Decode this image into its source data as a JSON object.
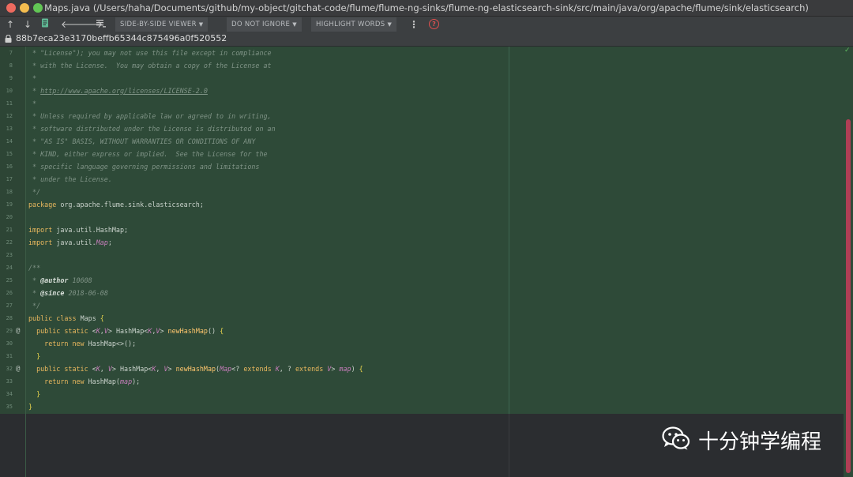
{
  "window": {
    "title": "Maps.java (/Users/haha/Documents/github/my-object/gitchat-code/flume/flume-ng-sinks/flume-ng-elasticsearch-sink/src/main/java/org/apache/flume/sink/elasticsearch)"
  },
  "toolbar": {
    "icons": [
      "arrow-up-icon",
      "arrow-down-icon",
      "edit-source-icon",
      "arrow-left-icon",
      "arrow-right-icon",
      "list-icon",
      "more-icon",
      "help-icon"
    ],
    "viewer_label": "SIDE-BY-SIDE VIEWER",
    "ignore_label": "DO NOT IGNORE",
    "highlight_label": "HIGHLIGHT WORDS",
    "more_symbol": "⋮",
    "help_symbol": "?"
  },
  "revision": {
    "hash": "88b7eca23e3170beffb65344c875496a0f520552"
  },
  "editor": {
    "lines": [
      {
        "n": "7",
        "mark": "",
        "tokens": [
          {
            "c": "cm",
            "t": " * \"License\"); you may not use this file except in compliance"
          }
        ]
      },
      {
        "n": "8",
        "mark": "",
        "tokens": [
          {
            "c": "cm",
            "t": " * with the License.  You may obtain a copy of the License at"
          }
        ]
      },
      {
        "n": "9",
        "mark": "",
        "tokens": [
          {
            "c": "cm",
            "t": " *"
          }
        ]
      },
      {
        "n": "10",
        "mark": "",
        "tokens": [
          {
            "c": "cm",
            "t": " * "
          },
          {
            "c": "cm-link",
            "t": "http://www.apache.org/licenses/LICENSE-2.0"
          }
        ]
      },
      {
        "n": "11",
        "mark": "",
        "tokens": [
          {
            "c": "cm",
            "t": " *"
          }
        ]
      },
      {
        "n": "12",
        "mark": "",
        "tokens": [
          {
            "c": "cm",
            "t": " * Unless required by applicable law or agreed to in writing,"
          }
        ]
      },
      {
        "n": "13",
        "mark": "",
        "tokens": [
          {
            "c": "cm",
            "t": " * software distributed under the License is distributed on an"
          }
        ]
      },
      {
        "n": "14",
        "mark": "",
        "tokens": [
          {
            "c": "cm",
            "t": " * \"AS IS\" BASIS, WITHOUT WARRANTIES OR CONDITIONS OF ANY"
          }
        ]
      },
      {
        "n": "15",
        "mark": "",
        "tokens": [
          {
            "c": "cm",
            "t": " * KIND, either express or implied.  See the License for the"
          }
        ]
      },
      {
        "n": "16",
        "mark": "",
        "tokens": [
          {
            "c": "cm",
            "t": " * specific language governing permissions and limitations"
          }
        ]
      },
      {
        "n": "17",
        "mark": "",
        "tokens": [
          {
            "c": "cm",
            "t": " * under the License."
          }
        ]
      },
      {
        "n": "18",
        "mark": "",
        "tokens": [
          {
            "c": "cm",
            "t": " */"
          }
        ]
      },
      {
        "n": "19",
        "mark": "",
        "tokens": [
          {
            "c": "kw",
            "t": "package "
          },
          {
            "c": "pkg",
            "t": "org.apache.flume.sink.elasticsearch;"
          }
        ]
      },
      {
        "n": "20",
        "mark": "",
        "tokens": []
      },
      {
        "n": "21",
        "mark": "",
        "tokens": [
          {
            "c": "kw",
            "t": "import "
          },
          {
            "c": "pkg",
            "t": "java.util.HashMap;"
          }
        ]
      },
      {
        "n": "22",
        "mark": "",
        "tokens": [
          {
            "c": "kw",
            "t": "import "
          },
          {
            "c": "pkg",
            "t": "java.util."
          },
          {
            "c": "typ",
            "t": "Map"
          },
          {
            "c": "pkg",
            "t": ";"
          }
        ]
      },
      {
        "n": "23",
        "mark": "",
        "tokens": []
      },
      {
        "n": "24",
        "mark": "",
        "tokens": [
          {
            "c": "cm",
            "t": "/**"
          }
        ]
      },
      {
        "n": "25",
        "mark": "",
        "tokens": [
          {
            "c": "cm",
            "t": " * "
          },
          {
            "c": "tag",
            "t": "@author"
          },
          {
            "c": "cm",
            "t": " 10608"
          }
        ]
      },
      {
        "n": "26",
        "mark": "",
        "tokens": [
          {
            "c": "cm",
            "t": " * "
          },
          {
            "c": "tag",
            "t": "@since"
          },
          {
            "c": "cm",
            "t": " 2018-06-08"
          }
        ]
      },
      {
        "n": "27",
        "mark": "",
        "tokens": [
          {
            "c": "cm",
            "t": " */"
          }
        ]
      },
      {
        "n": "28",
        "mark": "",
        "tokens": [
          {
            "c": "kw",
            "t": "public class "
          },
          {
            "c": "cls",
            "t": "Maps "
          },
          {
            "c": "brace",
            "t": "{"
          }
        ]
      },
      {
        "n": "29",
        "mark": "@",
        "tokens": [
          {
            "c": "plain",
            "t": "  "
          },
          {
            "c": "kw",
            "t": "public static "
          },
          {
            "c": "plain",
            "t": "<"
          },
          {
            "c": "typ",
            "t": "K"
          },
          {
            "c": "plain",
            "t": ","
          },
          {
            "c": "typ",
            "t": "V"
          },
          {
            "c": "plain",
            "t": "> HashMap<"
          },
          {
            "c": "typ",
            "t": "K"
          },
          {
            "c": "plain",
            "t": ","
          },
          {
            "c": "typ",
            "t": "V"
          },
          {
            "c": "plain",
            "t": "> "
          },
          {
            "c": "fn",
            "t": "newHashMap"
          },
          {
            "c": "plain",
            "t": "() "
          },
          {
            "c": "brace",
            "t": "{"
          }
        ]
      },
      {
        "n": "30",
        "mark": "",
        "tokens": [
          {
            "c": "plain",
            "t": "    "
          },
          {
            "c": "kw",
            "t": "return new "
          },
          {
            "c": "plain",
            "t": "HashMap<>();"
          }
        ]
      },
      {
        "n": "31",
        "mark": "",
        "tokens": [
          {
            "c": "plain",
            "t": "  "
          },
          {
            "c": "brace",
            "t": "}"
          }
        ]
      },
      {
        "n": "32",
        "mark": "@",
        "tokens": [
          {
            "c": "plain",
            "t": "  "
          },
          {
            "c": "kw",
            "t": "public static "
          },
          {
            "c": "plain",
            "t": "<"
          },
          {
            "c": "typ",
            "t": "K"
          },
          {
            "c": "plain",
            "t": ", "
          },
          {
            "c": "typ",
            "t": "V"
          },
          {
            "c": "plain",
            "t": "> HashMap<"
          },
          {
            "c": "typ",
            "t": "K"
          },
          {
            "c": "plain",
            "t": ", "
          },
          {
            "c": "typ",
            "t": "V"
          },
          {
            "c": "plain",
            "t": "> "
          },
          {
            "c": "fn",
            "t": "newHashMap"
          },
          {
            "c": "plain",
            "t": "("
          },
          {
            "c": "typ",
            "t": "Map"
          },
          {
            "c": "plain",
            "t": "<? "
          },
          {
            "c": "kw",
            "t": "extends "
          },
          {
            "c": "typ",
            "t": "K"
          },
          {
            "c": "plain",
            "t": ", ? "
          },
          {
            "c": "kw",
            "t": "extends "
          },
          {
            "c": "typ",
            "t": "V"
          },
          {
            "c": "plain",
            "t": "> "
          },
          {
            "c": "param",
            "t": "map"
          },
          {
            "c": "plain",
            "t": ") "
          },
          {
            "c": "brace",
            "t": "{"
          }
        ]
      },
      {
        "n": "33",
        "mark": "",
        "tokens": [
          {
            "c": "plain",
            "t": "    "
          },
          {
            "c": "kw",
            "t": "return new "
          },
          {
            "c": "plain",
            "t": "HashMap("
          },
          {
            "c": "param",
            "t": "map"
          },
          {
            "c": "plain",
            "t": ");"
          }
        ]
      },
      {
        "n": "34",
        "mark": "",
        "tokens": [
          {
            "c": "plain",
            "t": "  "
          },
          {
            "c": "brace",
            "t": "}"
          }
        ]
      },
      {
        "n": "35",
        "mark": "",
        "tokens": [
          {
            "c": "brace",
            "t": "}"
          }
        ]
      }
    ]
  },
  "watermark": {
    "text": "十分钟学编程",
    "logo": "wechat-logo-icon"
  },
  "colors": {
    "diff_background": "#2e4a38",
    "scroll_thumb": "#b03e55",
    "keyword": "#e9b85e"
  }
}
